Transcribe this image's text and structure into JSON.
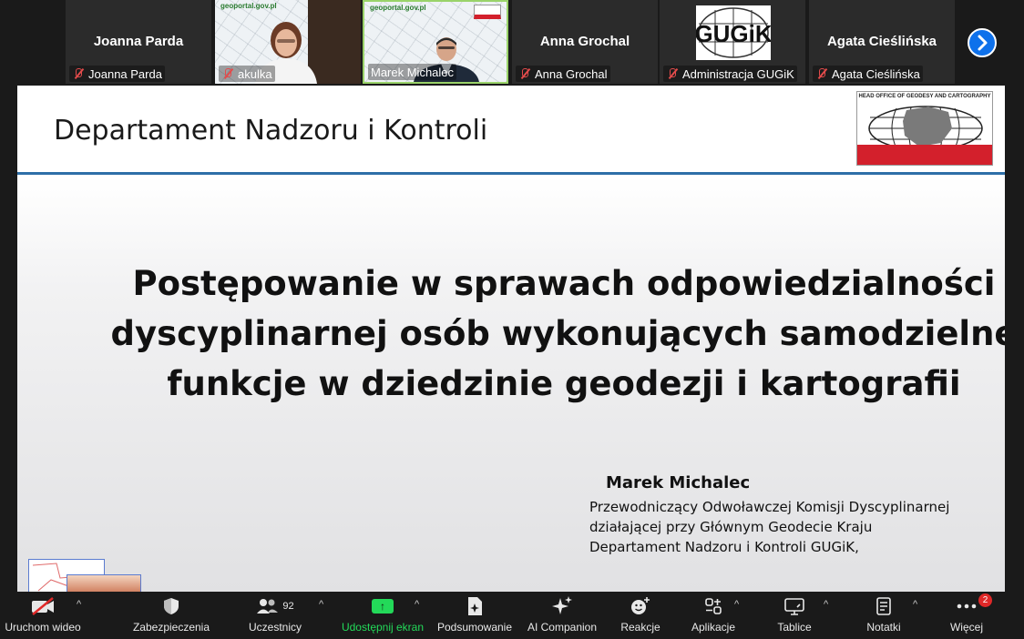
{
  "participants": [
    {
      "name": "Joanna Parda",
      "label": "Joanna Parda",
      "muted": true,
      "type": "name"
    },
    {
      "name": "",
      "label": "akulka",
      "muted": true,
      "type": "video",
      "site": "geoportal.gov.pl"
    },
    {
      "name": "",
      "label": "Marek Michalec",
      "muted": false,
      "type": "video",
      "site": "geoportal.gov.pl",
      "active": true
    },
    {
      "name": "Anna Grochal",
      "label": "Anna Grochal",
      "muted": true,
      "type": "name"
    },
    {
      "name": "",
      "label": "Administracja GUGiK",
      "muted": true,
      "type": "logo",
      "logo_text": "GUGiK"
    },
    {
      "name": "Agata Cieślińska",
      "label": "Agata Cieślińska",
      "muted": true,
      "type": "name"
    }
  ],
  "next_page_icon": "chevron-right",
  "slide": {
    "header_title": "Departament Nadzoru i Kontroli",
    "logo_caption": "HEAD OFFICE OF GEODESY AND CARTOGRAPHY",
    "main_title_lines": [
      "Postępowanie w sprawach odpowiedzialności",
      "dyscyplinarnej osób wykonujących samodzielne",
      "funkcje w dziedzinie geodezji i kartografii"
    ],
    "presenter_name": "Marek Michalec",
    "presenter_desc_lines": [
      "Przewodniczący Odwoławczej Komisji Dyscyplinarnej",
      "działającej przy Głównym Geodecie Kraju",
      "Departament Nadzoru i Kontroli GUGiK,"
    ],
    "accent_color": "#2e6fa8",
    "logo_red": "#d3202c"
  },
  "toolbar": {
    "video": "Uruchom wideo",
    "security": "Zabezpieczenia",
    "participants": "Uczestnicy",
    "participants_count": "92",
    "share": "Udostępnij ekran",
    "summary": "Podsumowanie",
    "ai": "AI Companion",
    "reactions": "Reakcje",
    "apps": "Aplikacje",
    "whiteboards": "Tablice",
    "notes": "Notatki",
    "more": "Więcej",
    "more_badge": "2",
    "share_color": "#23d959"
  }
}
